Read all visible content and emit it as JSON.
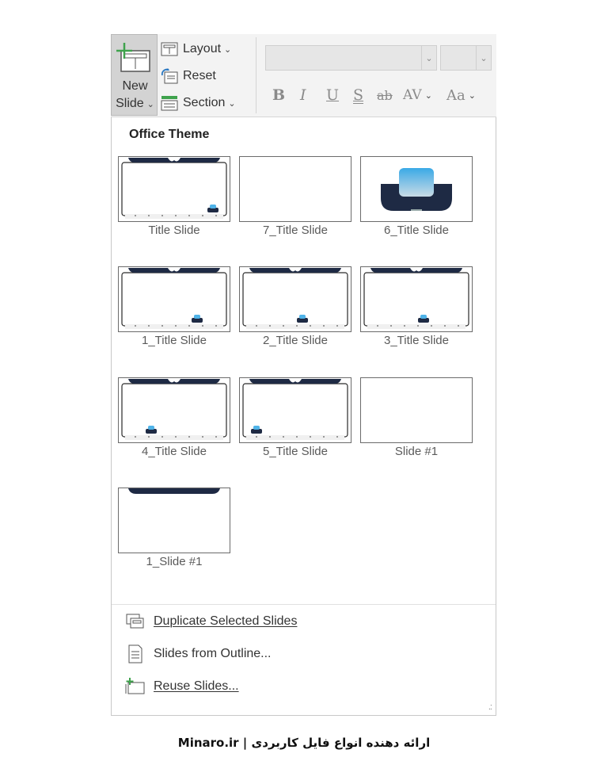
{
  "ribbon": {
    "new_slide_line1": "New",
    "new_slide_line2": "Slide",
    "layout_label": "Layout",
    "reset_label": "Reset",
    "section_label": "Section",
    "format_buttons": [
      "B",
      "I",
      "U",
      "S",
      "ab",
      "AV",
      "Aa"
    ]
  },
  "panel": {
    "section_title": "Office Theme",
    "layouts": [
      {
        "name": "Title Slide",
        "style": "frame-right"
      },
      {
        "name": "7_Title Slide",
        "style": "blank"
      },
      {
        "name": "6_Title Slide",
        "style": "dark-pill"
      },
      {
        "name": "1_Title Slide",
        "style": "frame-right-mid"
      },
      {
        "name": "2_Title Slide",
        "style": "frame-center"
      },
      {
        "name": "3_Title Slide",
        "style": "frame-center"
      },
      {
        "name": "4_Title Slide",
        "style": "frame-left"
      },
      {
        "name": "5_Title Slide",
        "style": "frame-left-edge"
      },
      {
        "name": "Slide #1",
        "style": "blank"
      },
      {
        "name": "1_Slide #1",
        "style": "top-bar"
      }
    ],
    "commands": {
      "duplicate": "Duplicate Selected Slides",
      "outline": "Slides from Outline...",
      "reuse": "Reuse Slides..."
    }
  },
  "colors": {
    "navy": "#1e2a44",
    "accent_blue": "#4fb3e8",
    "green": "#3fa34d"
  },
  "footer": {
    "text": "Minaro.ir | ارائه دهنده انواع فایل کاربردی"
  }
}
